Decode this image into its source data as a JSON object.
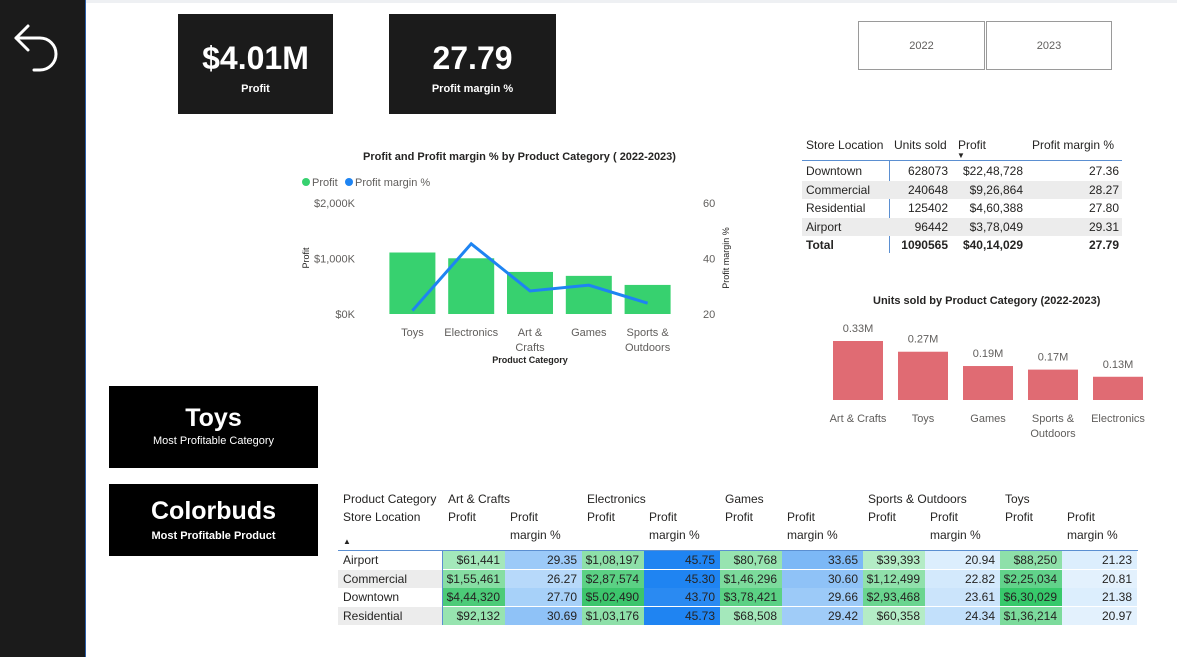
{
  "kpis": [
    {
      "value": "$4.01M",
      "label": "Profit"
    },
    {
      "value": "27.79",
      "label": "Profit margin %"
    }
  ],
  "year_slicer": {
    "options": [
      "2022",
      "2023"
    ]
  },
  "cards": [
    {
      "value": "Toys",
      "label": "Most Profitable Category"
    },
    {
      "value": "Colorbuds",
      "label": "Most Profitable Product"
    }
  ],
  "chart_data": [
    {
      "type": "bar",
      "title": "Profit and Profit margin % by Product Category ( 2022-2023)",
      "categories": [
        [
          "Toys"
        ],
        [
          "Electronics"
        ],
        [
          "Art &",
          "Crafts"
        ],
        [
          "Games"
        ],
        [
          "Sports &",
          "Outdoors"
        ]
      ],
      "legend": [
        "Profit",
        "Profit margin %"
      ],
      "xlabel": "Product Category",
      "ylabel": "Profit",
      "y2label": "Profit margin %",
      "yticks": [
        "$0K",
        "$1,000K",
        "$2,000K"
      ],
      "y2ticks": [
        "20",
        "40",
        "60"
      ],
      "ylim": [
        0,
        2000000
      ],
      "y2lim": [
        20,
        60
      ],
      "series": [
        {
          "name": "Profit",
          "type": "bar",
          "values": [
            1108000,
            1004000,
            758000,
            687000,
            524000
          ]
        },
        {
          "name": "Profit margin %",
          "type": "line",
          "axis": "right",
          "values": [
            21.2,
            45.3,
            28.3,
            30.4,
            23.9
          ]
        }
      ],
      "colors": {
        "bar": "#37d16f",
        "line": "#1e84f2"
      },
      "legend_position": "top-left"
    },
    {
      "type": "bar",
      "title": "Units sold by Product Category (2022-2023)",
      "categories": [
        [
          "Art & Crafts"
        ],
        [
          "Toys"
        ],
        [
          "Games"
        ],
        [
          "Sports &",
          "Outdoors"
        ],
        [
          "Electronics"
        ]
      ],
      "values": [
        330000,
        270000,
        190000,
        170000,
        130000
      ],
      "data_labels": [
        "0.33M",
        "0.27M",
        "0.19M",
        "0.17M",
        "0.13M"
      ],
      "ylim": [
        0,
        330000
      ],
      "colors": {
        "bar": "#e06b73"
      }
    }
  ],
  "store_table": {
    "headers": [
      "Store Location",
      "Units sold",
      "Profit",
      "Profit margin %"
    ],
    "rows": [
      [
        "Downtown",
        "628073",
        "$22,48,728",
        "27.36"
      ],
      [
        "Commercial",
        "240648",
        "$9,26,864",
        "28.27"
      ],
      [
        "Residential",
        "125402",
        "$4,60,388",
        "27.80"
      ],
      [
        "Airport",
        "96442",
        "$3,78,049",
        "29.31"
      ]
    ],
    "total": [
      "Total",
      "1090565",
      "$40,14,029",
      "27.79"
    ]
  },
  "matrix": {
    "row_header_1": "Product Category",
    "row_header_2": "Store Location",
    "categories": [
      "Art & Crafts",
      "Electronics",
      "Games",
      "Sports & Outdoors",
      "Toys"
    ],
    "measure_profit": "Profit",
    "measure_margin_1": "Profit",
    "measure_margin_2": "margin %",
    "rows": [
      {
        "location": "Airport",
        "values": [
          [
            "$61,441",
            "29.35"
          ],
          [
            "$1,08,197",
            "45.75"
          ],
          [
            "$80,768",
            "33.65"
          ],
          [
            "$39,393",
            "20.94"
          ],
          [
            "$88,250",
            "21.23"
          ]
        ]
      },
      {
        "location": "Commercial",
        "values": [
          [
            "$1,55,461",
            "26.27"
          ],
          [
            "$2,87,574",
            "45.30"
          ],
          [
            "$1,46,296",
            "30.60"
          ],
          [
            "$1,12,499",
            "22.82"
          ],
          [
            "$2,25,034",
            "20.81"
          ]
        ]
      },
      {
        "location": "Downtown",
        "values": [
          [
            "$4,44,320",
            "27.70"
          ],
          [
            "$5,02,490",
            "43.70"
          ],
          [
            "$3,78,421",
            "29.66"
          ],
          [
            "$2,93,468",
            "23.61"
          ],
          [
            "$6,30,029",
            "21.38"
          ]
        ]
      },
      {
        "location": "Residential",
        "values": [
          [
            "$92,132",
            "30.69"
          ],
          [
            "$1,03,176",
            "45.73"
          ],
          [
            "$68,508",
            "29.42"
          ],
          [
            "$60,358",
            "24.34"
          ],
          [
            "$1,36,214",
            "20.97"
          ]
        ]
      }
    ],
    "profit_colors": [
      [
        "#a4e8bb",
        "#8ee0a9",
        "#97e4b0",
        "#b4ecc6",
        "#8ee0a9"
      ],
      [
        "#86dea3",
        "#5bd184",
        "#7cdb9c",
        "#90e1ab",
        "#61d38a"
      ],
      [
        "#4ccb78",
        "#3cc56c",
        "#5bd184",
        "#6ad58f",
        "#37c96b"
      ],
      [
        "#97e4b0",
        "#8ee0a9",
        "#a4e8bb",
        "#b4ecc6",
        "#7cdb9c"
      ]
    ],
    "margin_colors": [
      [
        "#9ccaf8",
        "#1f84f2",
        "#7cb8f6",
        "#dceefd",
        "#dceefd"
      ],
      [
        "#b7d9fa",
        "#1f84f2",
        "#8fc2f7",
        "#d3e9fc",
        "#e3f1fd"
      ],
      [
        "#a7d1f9",
        "#2a8af2",
        "#9ccaf8",
        "#cbe4fb",
        "#dceefd"
      ],
      [
        "#8fc2f7",
        "#1f84f2",
        "#a0ccf8",
        "#c2e0fb",
        "#e3f1fd"
      ]
    ]
  }
}
